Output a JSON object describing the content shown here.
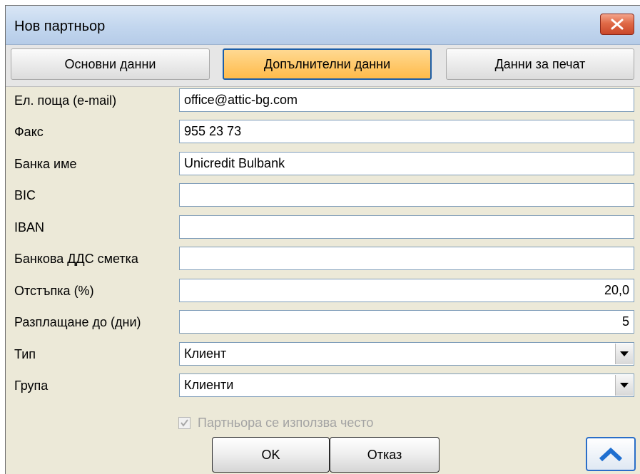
{
  "window": {
    "title": "Нов партньор",
    "close_icon": "close-x-icon"
  },
  "tabs": [
    {
      "label": "Основни данни",
      "active": false
    },
    {
      "label": "Допълнителни данни",
      "active": true
    },
    {
      "label": "Данни за печат",
      "active": false
    }
  ],
  "fields": {
    "email": {
      "label": "Ел. поща (e-mail)",
      "value": "office@attic-bg.com"
    },
    "fax": {
      "label": "Факс",
      "value": "955 23 73"
    },
    "bank_name": {
      "label": "Банка име",
      "value": "Unicredit Bulbank"
    },
    "bic": {
      "label": "BIC",
      "value": ""
    },
    "iban": {
      "label": "IBAN",
      "value": ""
    },
    "bank_vat_account": {
      "label": "Банкова ДДС сметка",
      "value": ""
    },
    "discount": {
      "label": "Отстъпка (%)",
      "value": "20,0"
    },
    "payment_days": {
      "label": "Разплащане до (дни)",
      "value": "5"
    },
    "type": {
      "label": "Тип",
      "value": "Клиент"
    },
    "group": {
      "label": "Група",
      "value": "Клиенти"
    }
  },
  "frequent_partner": {
    "label": "Партньора се използва често",
    "checked": true,
    "enabled": false
  },
  "buttons": {
    "ok": "OK",
    "cancel": "Отказ",
    "up_icon": "chevron-up-icon"
  },
  "colors": {
    "active_tab": "#ffbb4a",
    "active_tab_border": "#1c5ea8",
    "close_button": "#e06a47",
    "titlebar": "#c2d6ee"
  }
}
